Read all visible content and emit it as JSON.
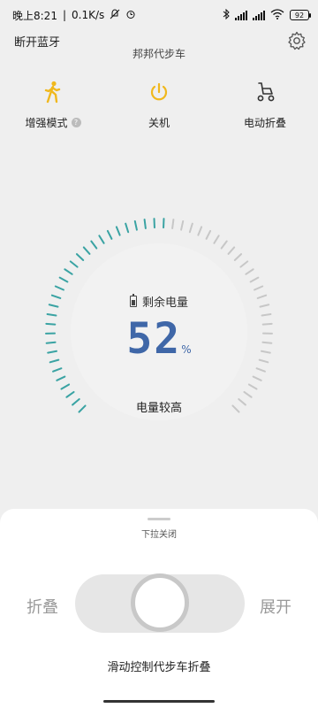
{
  "status_bar": {
    "time": "晚上8:21",
    "speed": "0.1K/s",
    "battery": "92"
  },
  "header": {
    "left_action": "断开蓝牙",
    "title": "邦邦代步车"
  },
  "actions": [
    {
      "label": "增强模式",
      "icon": "walker-icon"
    },
    {
      "label": "关机",
      "icon": "power-icon"
    },
    {
      "label": "电动折叠",
      "icon": "scooter-icon"
    }
  ],
  "gauge": {
    "title": "剩余电量",
    "value": "52",
    "unit": "%",
    "status": "电量较高",
    "level": 52,
    "accent": "#3aa3a3",
    "inactive_tick": "#c7c7c7"
  },
  "sheet": {
    "pull_hint": "下拉关闭",
    "left_label": "折叠",
    "right_label": "展开",
    "slide_hint": "滑动控制代步车折叠"
  },
  "colors": {
    "primary_text": "#3f67a8",
    "yellow_icon": "#f0b81d"
  }
}
